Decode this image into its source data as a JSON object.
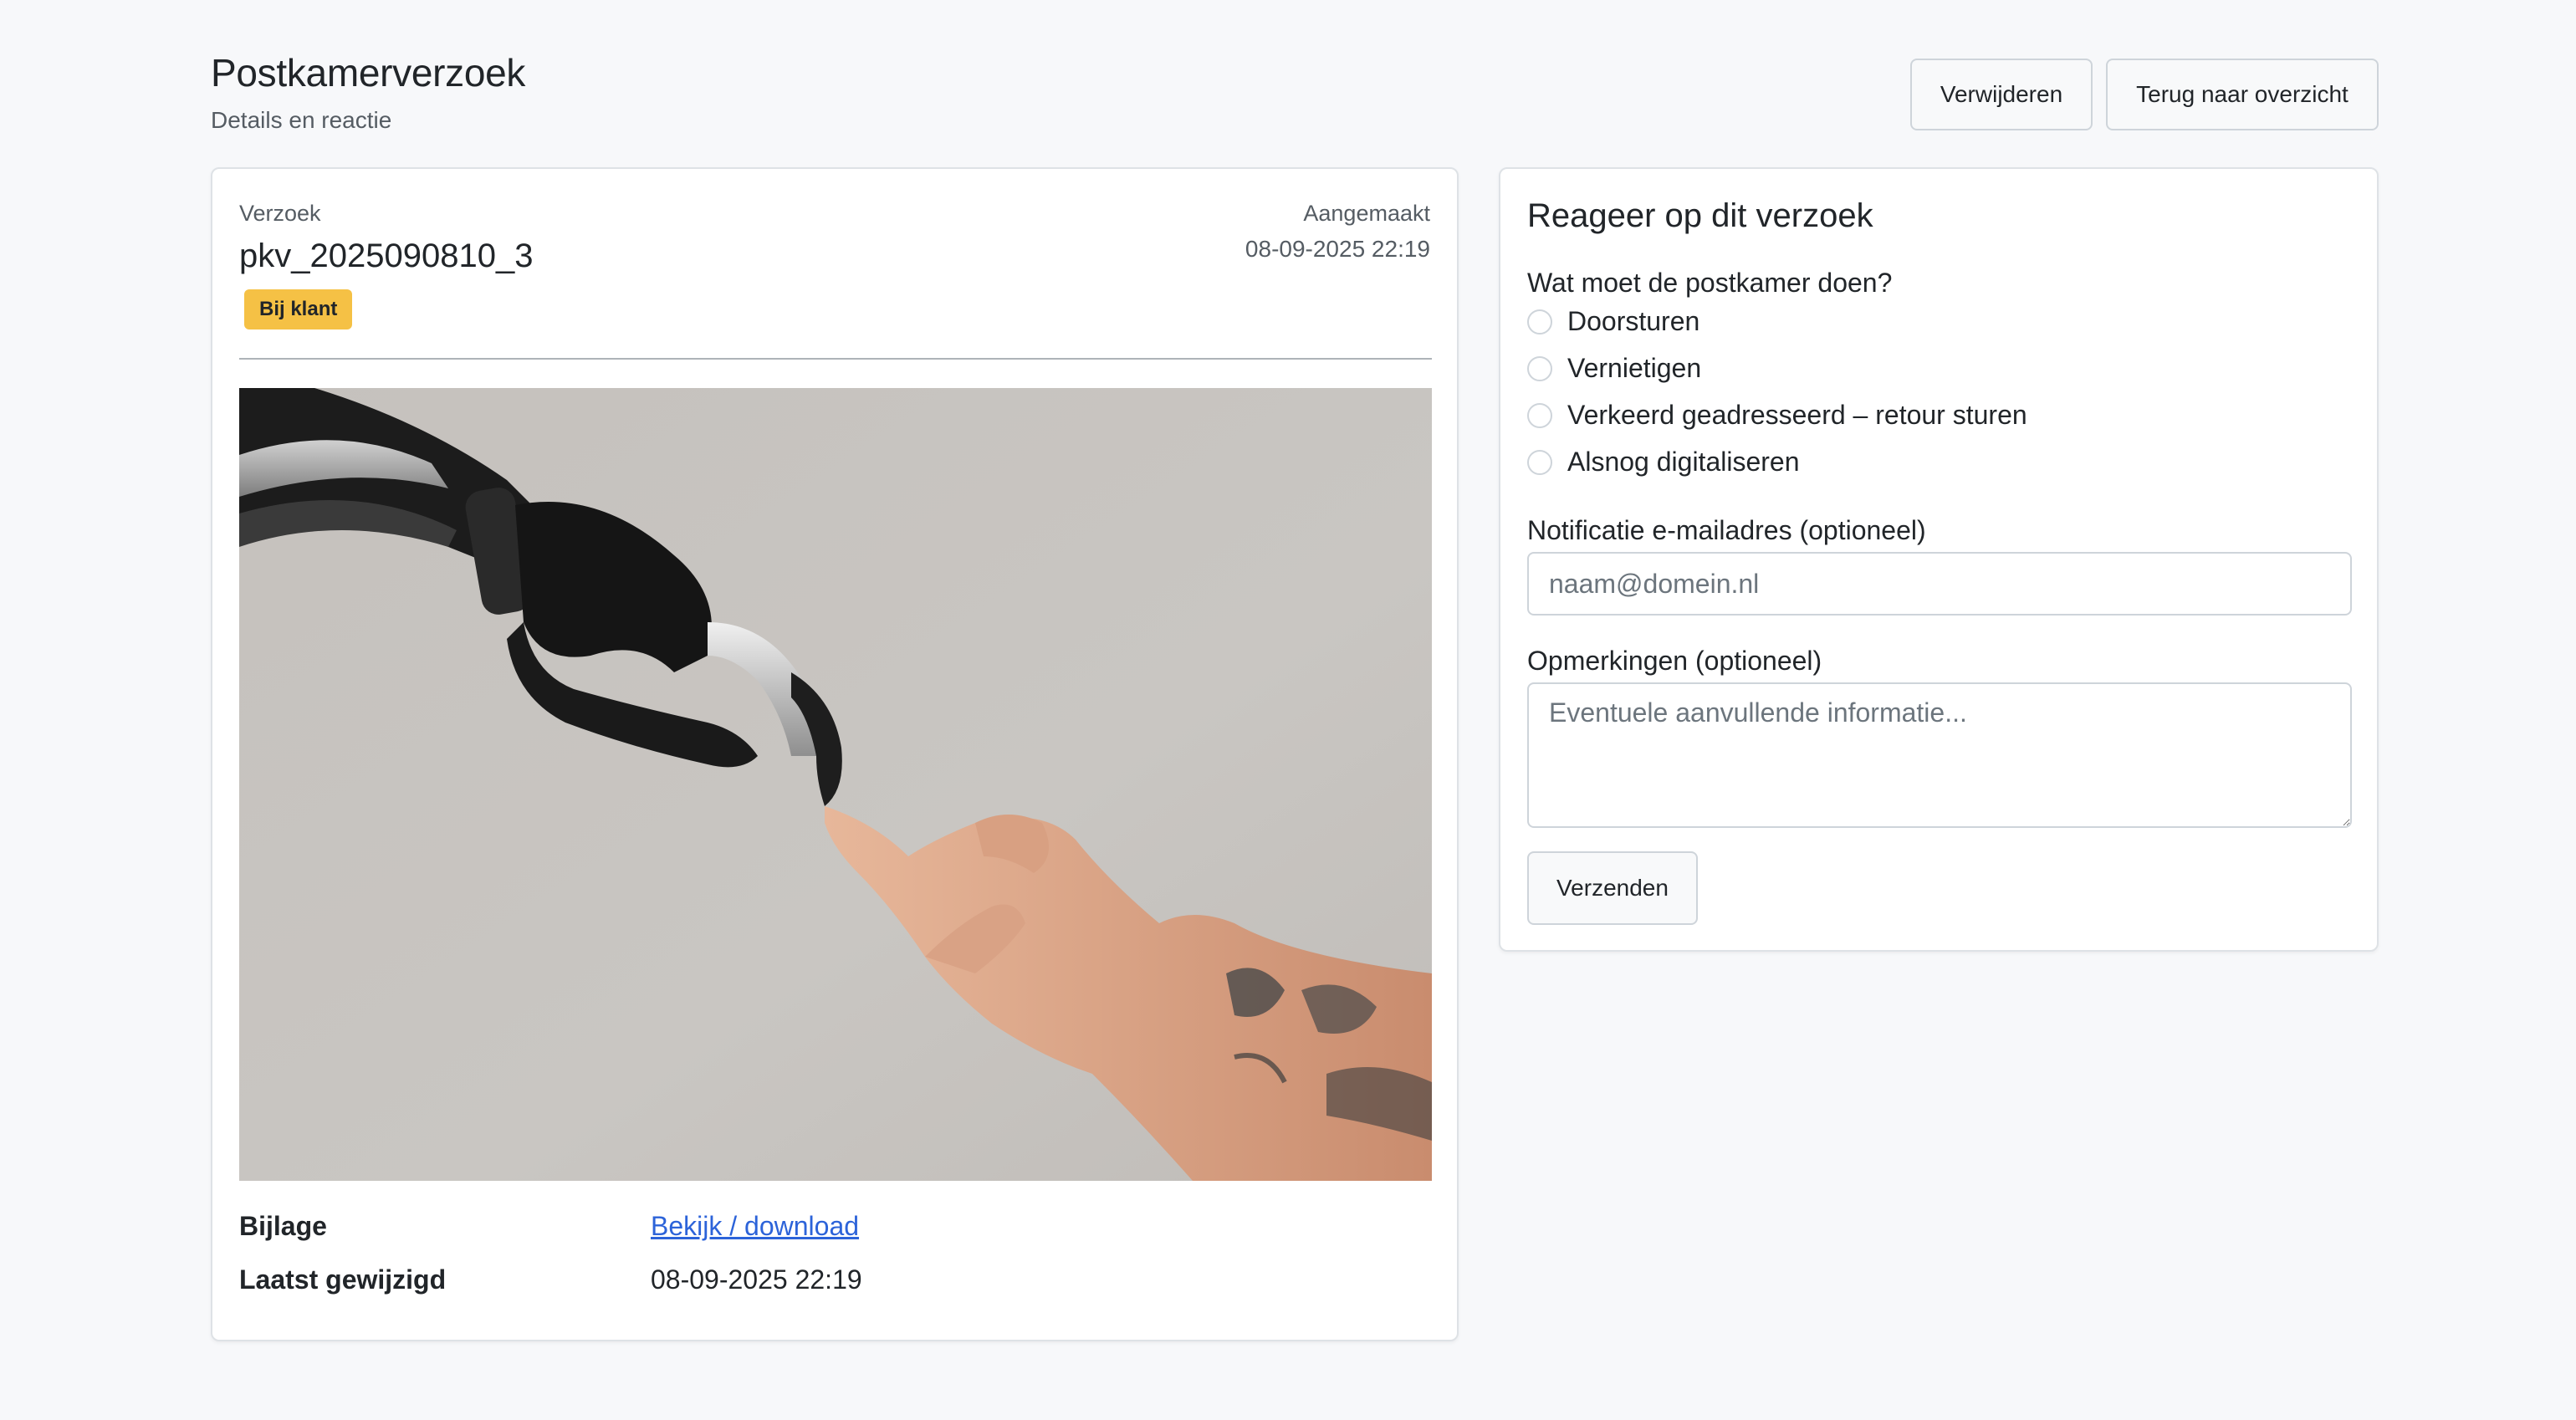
{
  "header": {
    "title": "Postkamerverzoek",
    "subtitle": "Details en reactie",
    "delete_label": "Verwijderen",
    "back_label": "Terug naar overzicht"
  },
  "request": {
    "label": "Verzoek",
    "id": "pkv_2025090810_3",
    "status_badge": "Bij klant",
    "created_label": "Aangemaakt",
    "created_value": "08-09-2025 22:19",
    "attachment_label": "Bijlage",
    "attachment_link": "Bekijk / download",
    "modified_label": "Laatst gewijzigd",
    "modified_value": "08-09-2025 22:19"
  },
  "form": {
    "title": "Reageer op dit verzoek",
    "question": "Wat moet de postkamer doen?",
    "options": [
      "Doorsturen",
      "Vernietigen",
      "Verkeerd geadresseerd – retour sturen",
      "Alsnog digitaliseren"
    ],
    "email_label": "Notificatie e-mailadres (optioneel)",
    "email_placeholder": "naam@domein.nl",
    "notes_label": "Opmerkingen (optioneel)",
    "notes_placeholder": "Eventuele aanvullende informatie...",
    "submit_label": "Verzenden"
  },
  "colors": {
    "badge": "#f5c145",
    "link": "#2c63d9",
    "background": "#f7f8fa"
  }
}
